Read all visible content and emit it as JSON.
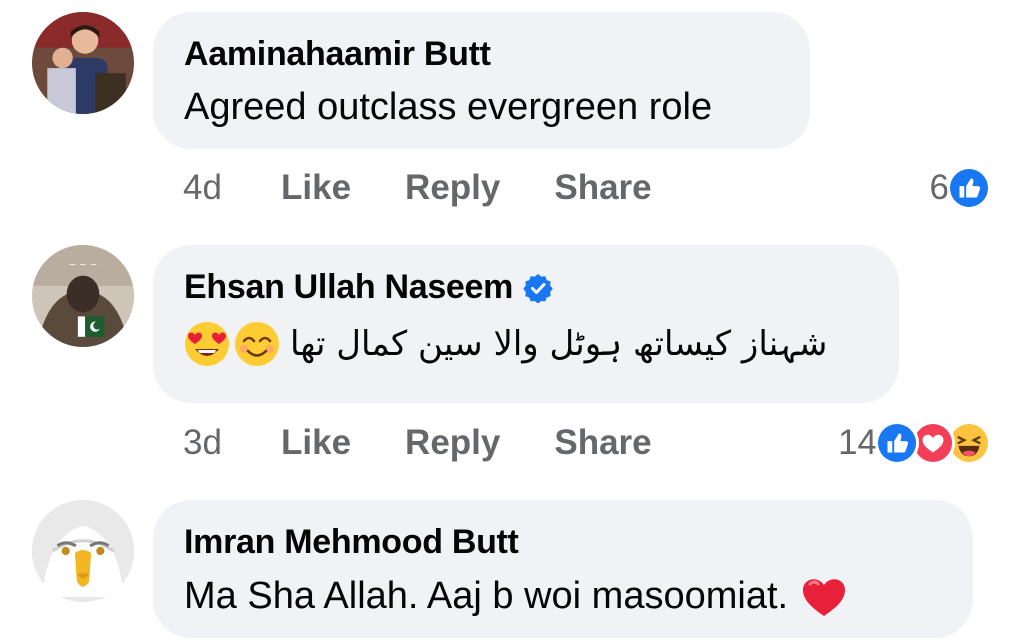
{
  "comments": [
    {
      "author": "Aaminahaamir Butt",
      "text": "Agreed outclass evergreen role",
      "time": "4d",
      "like": "Like",
      "reply": "Reply",
      "share": "Share",
      "reaction_count": "6",
      "reactions": [
        "like-icon"
      ]
    },
    {
      "author": "Ehsan Ullah Naseem",
      "verified": true,
      "text": "شہناز کیساتھ ہوٹل والا سین کمال تھا",
      "emojis": [
        "smiling-face-with-smiling-eyes-emoji",
        "heart-eyes-emoji"
      ],
      "time": "3d",
      "like": "Like",
      "reply": "Reply",
      "share": "Share",
      "reaction_count": "14",
      "reactions": [
        "like-icon",
        "love-icon",
        "haha-icon"
      ]
    },
    {
      "author": "Imran Mehmood Butt",
      "text": "Ma Sha Allah. Aaj b woi masoomiat.",
      "emojis": [
        "red-heart-emoji"
      ]
    }
  ],
  "colors": {
    "bubble": "#f0f2f5",
    "secondary_text": "#65676b",
    "like_blue": "#1877f2",
    "love_red": "#f33e58",
    "verified_blue": "#1877f2"
  }
}
